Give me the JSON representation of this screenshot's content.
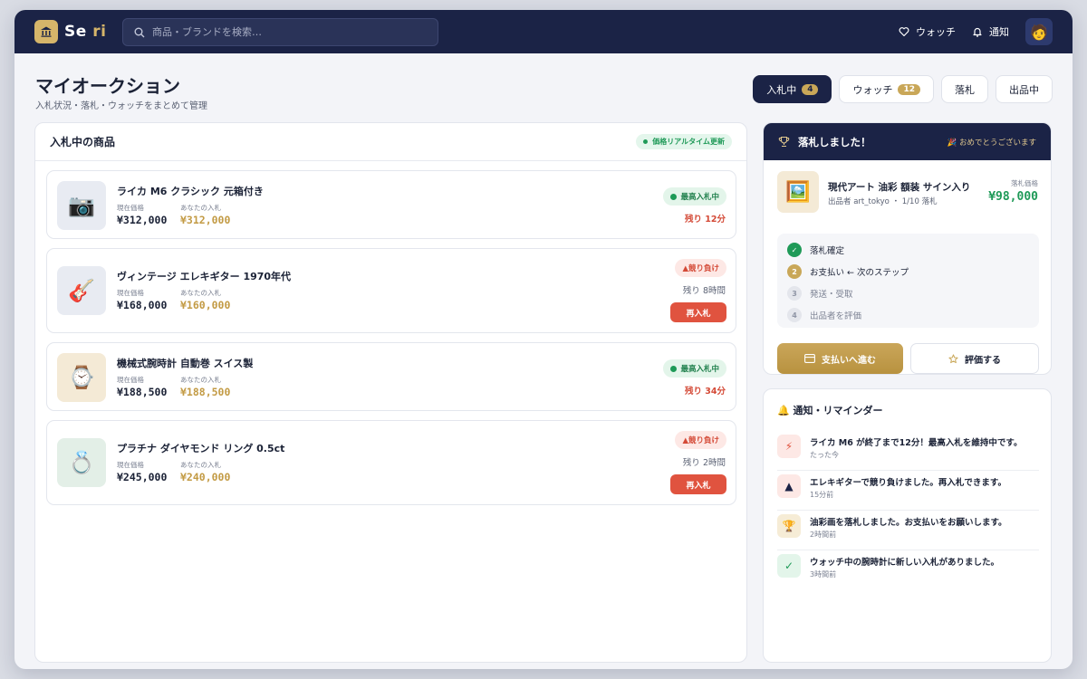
{
  "brand": {
    "name_part1": "Se",
    "name_part2": "ri",
    "logo_icon": "bank-icon"
  },
  "search": {
    "placeholder": "商品・ブランドを検索…"
  },
  "nav": {
    "watch_label": "ウォッチ",
    "notify_label": "通知",
    "avatar_emoji": "🧑"
  },
  "page": {
    "title": "マイオークション",
    "subtitle": "入札状況・落札・ウォッチをまとめて管理"
  },
  "tabs": [
    {
      "label": "入札中",
      "count": "4",
      "active": true
    },
    {
      "label": "ウォッチ",
      "count": "12",
      "active": false
    },
    {
      "label": "落札",
      "count": "",
      "active": false
    },
    {
      "label": "出品中",
      "count": "",
      "active": false
    }
  ],
  "bids_panel": {
    "title": "入札中の商品",
    "live_label": "価格リアルタイム更新",
    "current_label": "現在価格",
    "mine_label": "あなたの入札",
    "rebid_label": "再入札",
    "items": [
      {
        "name": "ライカ M6 クラシック 元箱付き",
        "icon": "camera-icon",
        "emoji": "📷",
        "current": "¥312,000",
        "mine": "¥312,000",
        "status": "最高入札中",
        "status_type": "top",
        "remaining": "残り 12分",
        "urgent": true
      },
      {
        "name": "ヴィンテージ エレキギター 1970年代",
        "icon": "guitar-icon",
        "emoji": "🎸",
        "current": "¥168,000",
        "mine": "¥160,000",
        "status": "▲競り負け",
        "status_type": "out",
        "remaining": "残り 8時間",
        "urgent": false
      },
      {
        "name": "機械式腕時計 自動巻 スイス製",
        "icon": "watch-icon",
        "emoji": "⌚",
        "current": "¥188,500",
        "mine": "¥188,500",
        "status": "最高入札中",
        "status_type": "top",
        "remaining": "残り 34分",
        "urgent": true
      },
      {
        "name": "プラチナ ダイヤモンド リング 0.5ct",
        "icon": "ring-icon",
        "emoji": "💍",
        "current": "¥245,000",
        "mine": "¥240,000",
        "status": "▲競り負け",
        "status_type": "out",
        "remaining": "残り 2時間",
        "urgent": false
      }
    ]
  },
  "won": {
    "title": "落札しました！",
    "congrats": "🎉 おめでとうございます",
    "item_name": "現代アート 油彩 額装 サイン入り",
    "seller": "出品者 art_tokyo ・ 1/10 落札",
    "price_label": "落札価格",
    "price": "¥98,000",
    "item_emoji": "🖼️",
    "steps": [
      {
        "num": "✓",
        "label": "落札確定",
        "state": "done"
      },
      {
        "num": "2",
        "label": "お支払い ← 次のステップ",
        "state": "cur"
      },
      {
        "num": "3",
        "label": "発送・受取",
        "state": "todo"
      },
      {
        "num": "4",
        "label": "出品者を評価",
        "state": "todo"
      }
    ],
    "pay_label": "支払いへ進む",
    "rate_label": "評価する"
  },
  "notifications": {
    "title": "🔔 通知・リマインダー",
    "items": [
      {
        "icon": "lightning-icon",
        "glyph": "⚡",
        "bg": "#fde8e5",
        "color": "#e0533f",
        "message": "ライカ M6 が終了まで12分！最高入札を維持中です。",
        "time": "たった今"
      },
      {
        "icon": "triangle-icon",
        "glyph": "▲",
        "bg": "#fde8e5",
        "color": "#1b2346",
        "message": "エレキギターで競り負けました。再入札できます。",
        "time": "15分前"
      },
      {
        "icon": "trophy-icon",
        "glyph": "🏆",
        "bg": "#f6ecd6",
        "color": "#c39b45",
        "message": "油彩画を落札しました。お支払いをお願いします。",
        "time": "2時間前"
      },
      {
        "icon": "check-icon",
        "glyph": "✓",
        "bg": "#e3f5ea",
        "color": "#1f9a58",
        "message": "ウォッチ中の腕時計に新しい入札がありました。",
        "time": "3時間前"
      }
    ]
  },
  "colors": {
    "navy": "#1b2346",
    "gold": "#c9a758",
    "green": "#1f9a58",
    "red": "#e0533f"
  }
}
